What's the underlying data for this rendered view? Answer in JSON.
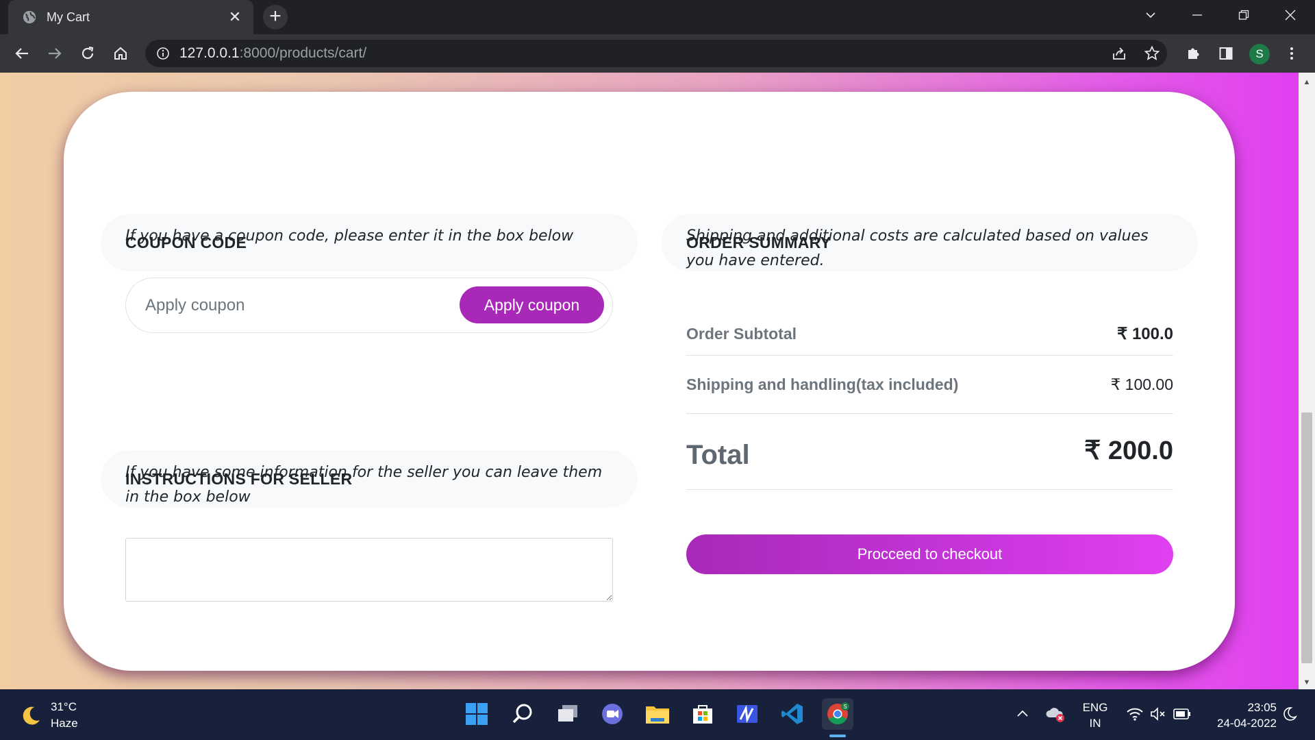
{
  "browser": {
    "tab_title": "My Cart",
    "tab_close": "✕",
    "new_tab": "+",
    "url_host": "127.0.0.1",
    "url_path": ":8000/products/cart/",
    "avatar_letter": "S"
  },
  "coupon": {
    "heading": "COUPON CODE",
    "note": "If you have a coupon code, please enter it in the box below",
    "input_placeholder": "Apply coupon",
    "button_label": "Apply coupon"
  },
  "seller": {
    "heading": "INSTRUCTIONS FOR SELLER",
    "note": "If you have some information for the seller you can leave them in the box below",
    "textarea_value": ""
  },
  "summary": {
    "heading": "ORDER SUMMARY",
    "note": "Shipping and additional costs are calculated based on values you have entered.",
    "subtotal_label": "Order Subtotal",
    "subtotal_value": "₹ 100.0",
    "shipping_label": "Shipping and handling(tax included)",
    "shipping_value": "₹ 100.00",
    "total_label": "Total",
    "total_value": "₹ 200.0",
    "checkout_label": "Procceed to checkout"
  },
  "taskbar": {
    "temperature": "31°C",
    "weather": "Haze",
    "language": "ENG",
    "region": "IN",
    "time": "23:05",
    "date": "24-04-2022",
    "chrome_badge": "S"
  },
  "colors": {
    "accent": "#a829b8",
    "accent_end": "#e040f0"
  }
}
